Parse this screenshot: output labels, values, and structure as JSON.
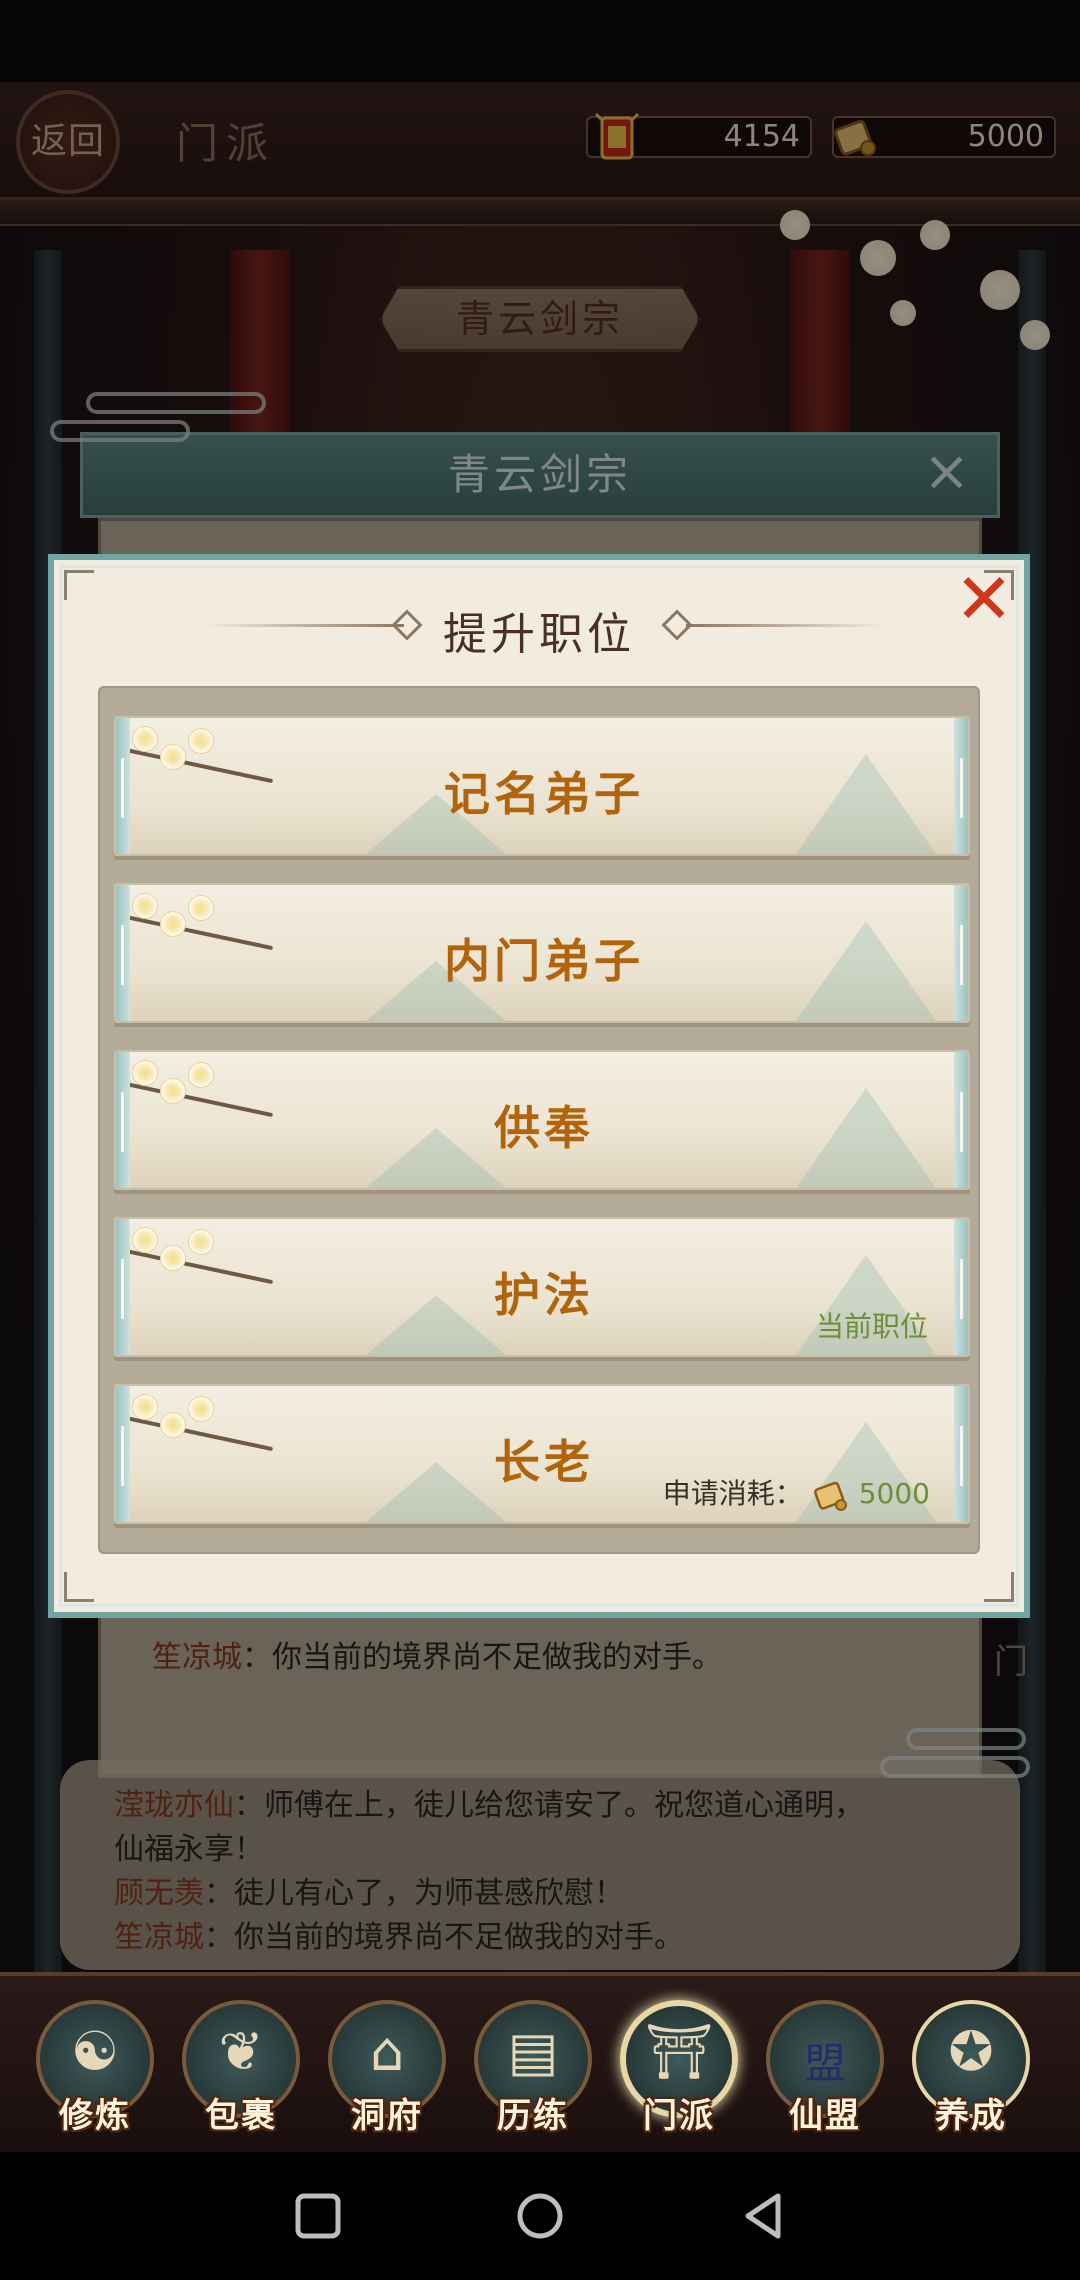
{
  "header": {
    "back_label": "返回",
    "title": "门派",
    "currency_1": {
      "value": "4154",
      "icon": "red-token-icon"
    },
    "currency_2": {
      "value": "5000",
      "icon": "gold-scroll-icon"
    }
  },
  "sect_banner": "青云剑宗",
  "back_dialog": {
    "title": "青云剑宗",
    "chat_top": [
      {
        "name": "笙凉城",
        "text": "：你当前的境界尚不足做我的对手。"
      }
    ],
    "chat": [
      {
        "name": "滢珑亦仙",
        "text": "：师傅在上，徒儿给您请安了。祝您道心通明，"
      },
      {
        "name": "",
        "text": "仙福永享！"
      },
      {
        "name": "顾无羡",
        "text": "：徒儿有心了，为师甚感欣慰！"
      },
      {
        "name": "笙凉城",
        "text": "：你当前的境界尚不足做我的对手。"
      }
    ],
    "side_label": "门"
  },
  "modal": {
    "title": "提升职位",
    "close_icon": "close-x-icon",
    "ranks": [
      {
        "name": "记名弟子",
        "status": "",
        "cost_label": "",
        "cost_value": ""
      },
      {
        "name": "内门弟子",
        "status": "",
        "cost_label": "",
        "cost_value": ""
      },
      {
        "name": "供奉",
        "status": "",
        "cost_label": "",
        "cost_value": ""
      },
      {
        "name": "护法",
        "status": "当前职位",
        "cost_label": "",
        "cost_value": ""
      },
      {
        "name": "长老",
        "status": "",
        "cost_label": "申请消耗：",
        "cost_value": "5000"
      }
    ]
  },
  "bottom_nav": {
    "items": [
      {
        "label": "修炼",
        "icon": "cultivator-icon",
        "active": false
      },
      {
        "label": "包裹",
        "icon": "bag-icon",
        "active": false
      },
      {
        "label": "洞府",
        "icon": "mansion-icon",
        "active": false
      },
      {
        "label": "历练",
        "icon": "scroll-icon",
        "active": false
      },
      {
        "label": "门派",
        "icon": "gate-icon",
        "active": true
      },
      {
        "label": "仙盟",
        "icon": "alliance-crown-icon",
        "active": false
      },
      {
        "label": "养成",
        "icon": "pentagram-icon",
        "active": false
      }
    ],
    "alliance_glyph": "盟"
  },
  "colors": {
    "accent_teal": "#6fa6a4",
    "rank_text": "#b2640c",
    "status_green": "#6c8f3a",
    "close_red": "#d0361c"
  }
}
